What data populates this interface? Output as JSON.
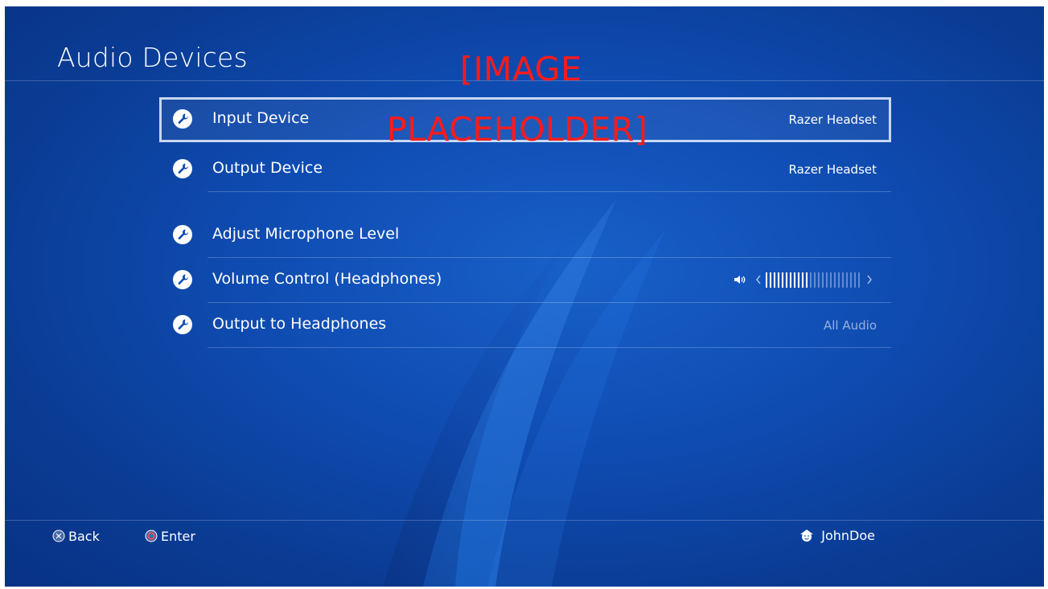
{
  "header": {
    "title": "Audio Devices"
  },
  "placeholder": {
    "line1": "[IMAGE",
    "line2": "PLACEHOLDER]"
  },
  "menu": {
    "items": [
      {
        "label": "Input Device",
        "value": "Razer Headset",
        "icon": "wrench-icon",
        "selected": true
      },
      {
        "label": "Output Device",
        "value": "Razer Headset",
        "icon": "wrench-icon",
        "selected": false
      },
      {
        "label": "Adjust Microphone Level",
        "value": "",
        "icon": "wrench-icon",
        "selected": false
      },
      {
        "label": "Volume Control (Headphones)",
        "icon": "wrench-icon",
        "selected": false,
        "volume_level": 11,
        "volume_max": 24
      },
      {
        "label": "Output to Headphones",
        "value": "All Audio",
        "icon": "wrench-icon",
        "selected": false
      }
    ]
  },
  "footer": {
    "back_label": "Back",
    "enter_label": "Enter",
    "back_icon": "cross-button-icon",
    "enter_icon": "circle-button-icon",
    "username": "JohnDoe",
    "user_icon": "user-avatar-icon"
  },
  "colors": {
    "background": "#0f4cb2",
    "placeholder_text": "#ff1a1a",
    "text": "#ffffff"
  }
}
